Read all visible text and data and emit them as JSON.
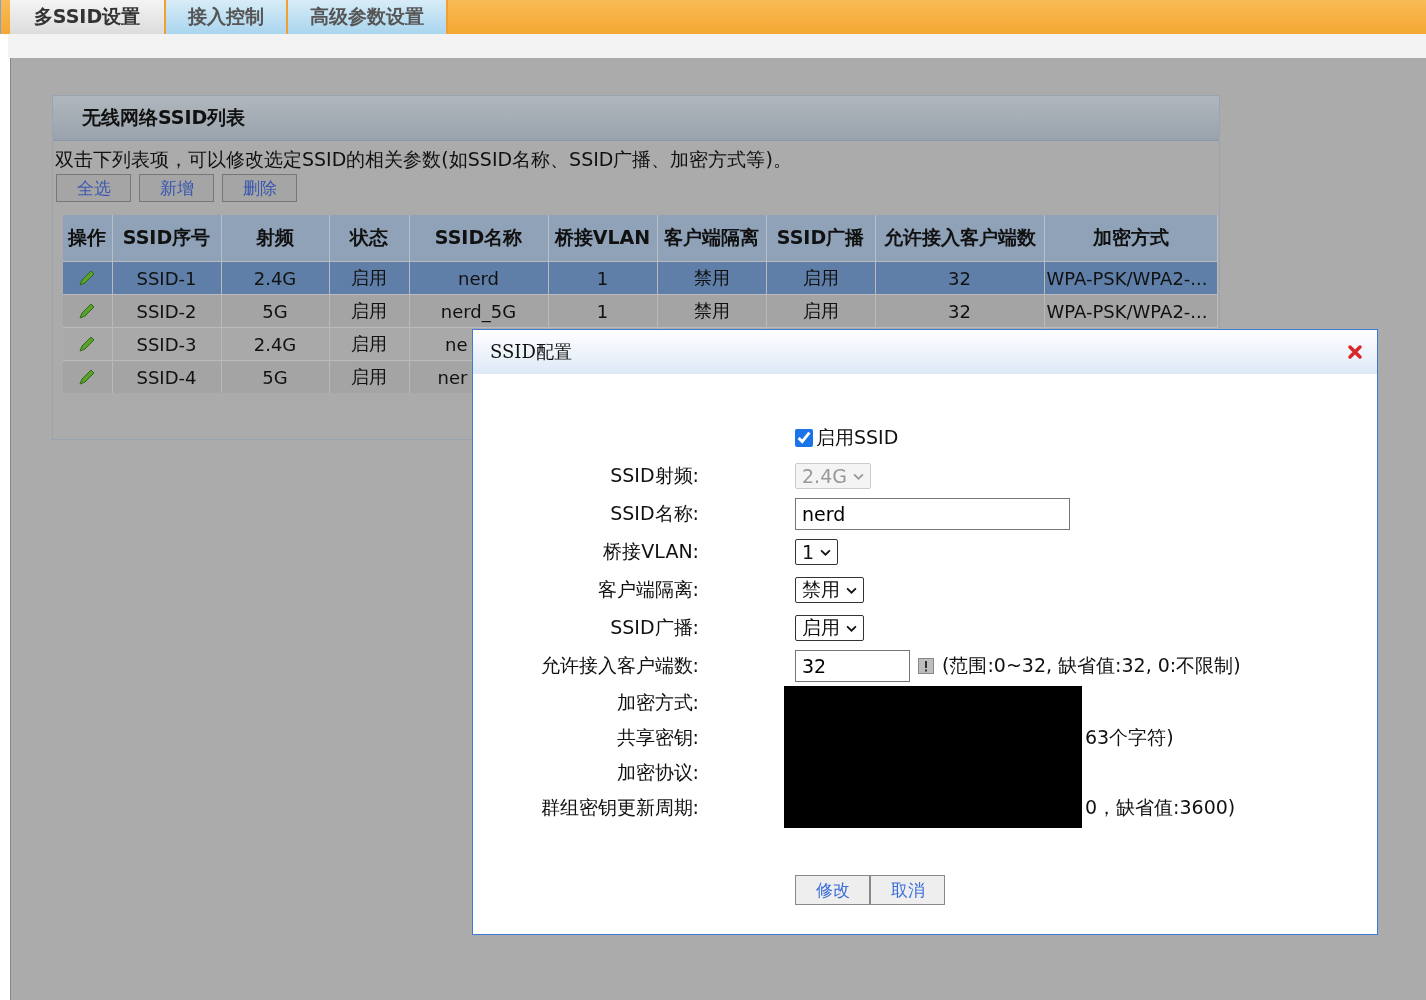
{
  "tabs": [
    {
      "label": "多SSID设置",
      "selected": true
    },
    {
      "label": "接入控制",
      "selected": false
    },
    {
      "label": "高级参数设置",
      "selected": false
    }
  ],
  "panel": {
    "title": "无线网络SSID列表",
    "hint": "双击下列表项，可以修改选定SSID的相关参数(如SSID名称、SSID广播、加密方式等)。",
    "buttons": [
      "全选",
      "新增",
      "删除"
    ]
  },
  "table": {
    "columns": [
      "操作",
      "SSID序号",
      "射频",
      "状态",
      "SSID名称",
      "桥接VLAN",
      "客户端隔离",
      "SSID广播",
      "允许接入客户端数",
      "加密方式"
    ],
    "rows": [
      {
        "selected": true,
        "cells": [
          "",
          "SSID-1",
          "2.4G",
          "启用",
          "nerd",
          "1",
          "禁用",
          "启用",
          "32",
          "WPA-PSK/WPA2-..."
        ]
      },
      {
        "selected": false,
        "cells": [
          "",
          "SSID-2",
          "5G",
          "启用",
          "nerd_5G",
          "1",
          "禁用",
          "启用",
          "32",
          "WPA-PSK/WPA2-..."
        ]
      },
      {
        "selected": false,
        "cells": [
          "",
          "SSID-3",
          "2.4G",
          "启用",
          "ne"
        ]
      },
      {
        "selected": false,
        "cells": [
          "",
          "SSID-4",
          "5G",
          "启用",
          "ner"
        ]
      }
    ]
  },
  "dialog": {
    "title": "SSID配置",
    "enable": {
      "label": "启用SSID",
      "checked": true
    },
    "fields": [
      {
        "kind": "select",
        "label": "SSID射频:",
        "value": "2.4G",
        "disabled": true
      },
      {
        "kind": "text",
        "label": "SSID名称:",
        "value": "nerd"
      },
      {
        "kind": "select",
        "label": "桥接VLAN:",
        "value": "1",
        "disabled": false
      },
      {
        "kind": "select",
        "label": "客户端隔离:",
        "value": "禁用",
        "disabled": false
      },
      {
        "kind": "select",
        "label": "SSID广播:",
        "value": "启用",
        "disabled": false
      },
      {
        "kind": "number",
        "label": "允许接入客户端数:",
        "value": "32",
        "note": "(范围:0~32, 缺省值:32, 0:不限制)"
      },
      {
        "kind": "hidden",
        "label": "加密方式:"
      },
      {
        "kind": "hidden",
        "label": "共享密钥:",
        "note": "63个字符)"
      },
      {
        "kind": "hidden",
        "label": "加密协议:"
      },
      {
        "kind": "hidden",
        "label": "群组密钥更新周期:",
        "note": "0，缺省值:3600)"
      }
    ],
    "buttons": [
      "修改",
      "取消"
    ]
  }
}
